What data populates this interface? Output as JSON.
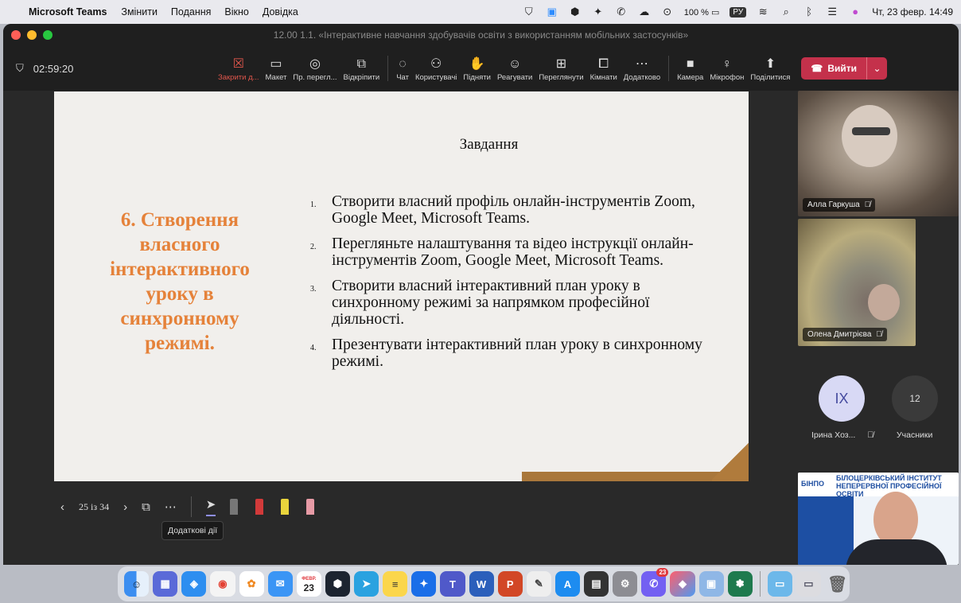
{
  "menubar": {
    "app_name": "Microsoft Teams",
    "menus": [
      "Змінити",
      "Подання",
      "Вікно",
      "Довідка"
    ],
    "battery": "100 %",
    "input_lang": "РУ",
    "datetime": "Чт, 23 февр.  14:49"
  },
  "window": {
    "title": "12.00 1.1. «Інтерактивне навчання здобувачів освіти з використанням мобільних застосунків»"
  },
  "toolbar": {
    "timer": "02:59:20",
    "buttons": [
      {
        "label": "Закрити д...",
        "icon": "close-share-icon"
      },
      {
        "label": "Макет",
        "icon": "layout-icon"
      },
      {
        "label": "Пр. перегл...",
        "icon": "eye-icon"
      },
      {
        "label": "Відкріпити",
        "icon": "popout-icon"
      },
      {
        "label": "Чат",
        "icon": "chat-icon"
      },
      {
        "label": "Користувачі",
        "icon": "people-icon"
      },
      {
        "label": "Підняти",
        "icon": "raise-hand-icon"
      },
      {
        "label": "Реагувати",
        "icon": "smile-icon"
      },
      {
        "label": "Переглянути",
        "icon": "view-icon"
      },
      {
        "label": "Кімнати",
        "icon": "rooms-icon"
      },
      {
        "label": "Додатково",
        "icon": "more-icon"
      },
      {
        "label": "Камера",
        "icon": "camera-icon"
      },
      {
        "label": "Мікрофон",
        "icon": "mic-icon"
      },
      {
        "label": "Поділитися",
        "icon": "share-icon"
      }
    ],
    "leave_label": "Вийти"
  },
  "slide": {
    "heading": "6. Створення власного інтерактивного уроку в синхронному режимі.",
    "title": "Завдання",
    "tasks": [
      {
        "num": "1.",
        "text": "Створити власний профіль онлайн-інструментів Zoom, Google Meet, Microsoft Teams."
      },
      {
        "num": "2.",
        "text": "Перегляньте налаштування та відео інструкції онлайн-інструментів Zoom, Google Meet, Microsoft Teams."
      },
      {
        "num": "3.",
        "text": "Створити власний інтерактивний план уроку в синхронному режимі за напрямком професійної діяльності."
      },
      {
        "num": "4.",
        "text": "Презентувати інтерактивний план уроку в синхронному режимі."
      }
    ],
    "accent_color": "#e5823a"
  },
  "slide_controls": {
    "page_indicator": "25 із 34",
    "tooltip": "Додаткові дії"
  },
  "participants": {
    "tile1_name": "Алла Гаркуша",
    "tile2_name": "Олена Дмитрієва",
    "avatar1_initials": "ІХ",
    "avatar1_name": "Ірина Хоз...",
    "participants_count": "12",
    "participants_label": "Учасники",
    "banner_title": "БІЛОЦЕРКІВСЬКИЙ ІНСТИТУТ НЕПЕРЕРВНОЇ ПРОФЕСІЙНОЇ ОСВІТИ",
    "banner_logo": "БІНПО"
  },
  "dock": {
    "calendar_day": "23",
    "calendar_month": "ФЕВР.",
    "viber_badge": "23"
  }
}
